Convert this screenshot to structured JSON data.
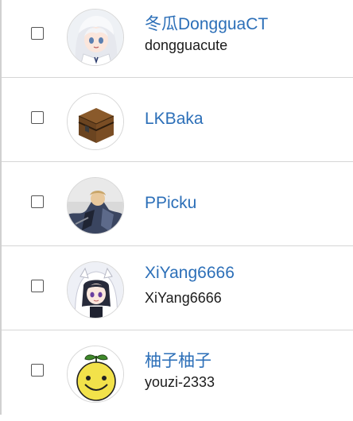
{
  "users": [
    {
      "display_name": "冬瓜DongguaCT",
      "username": "dongguacute",
      "avatar": "anime-girl-white-hair-avatar"
    },
    {
      "display_name": "LKBaka",
      "username": "",
      "avatar": "wooden-chest-avatar"
    },
    {
      "display_name": "PPicku",
      "username": "",
      "avatar": "armored-knight-avatar"
    },
    {
      "display_name": "XiYang6666",
      "username": "XiYang6666",
      "avatar": "anime-girl-hood-avatar"
    },
    {
      "display_name": "柚子柚子",
      "username": "youzi-2333",
      "avatar": "smiley-fruit-avatar"
    }
  ]
}
